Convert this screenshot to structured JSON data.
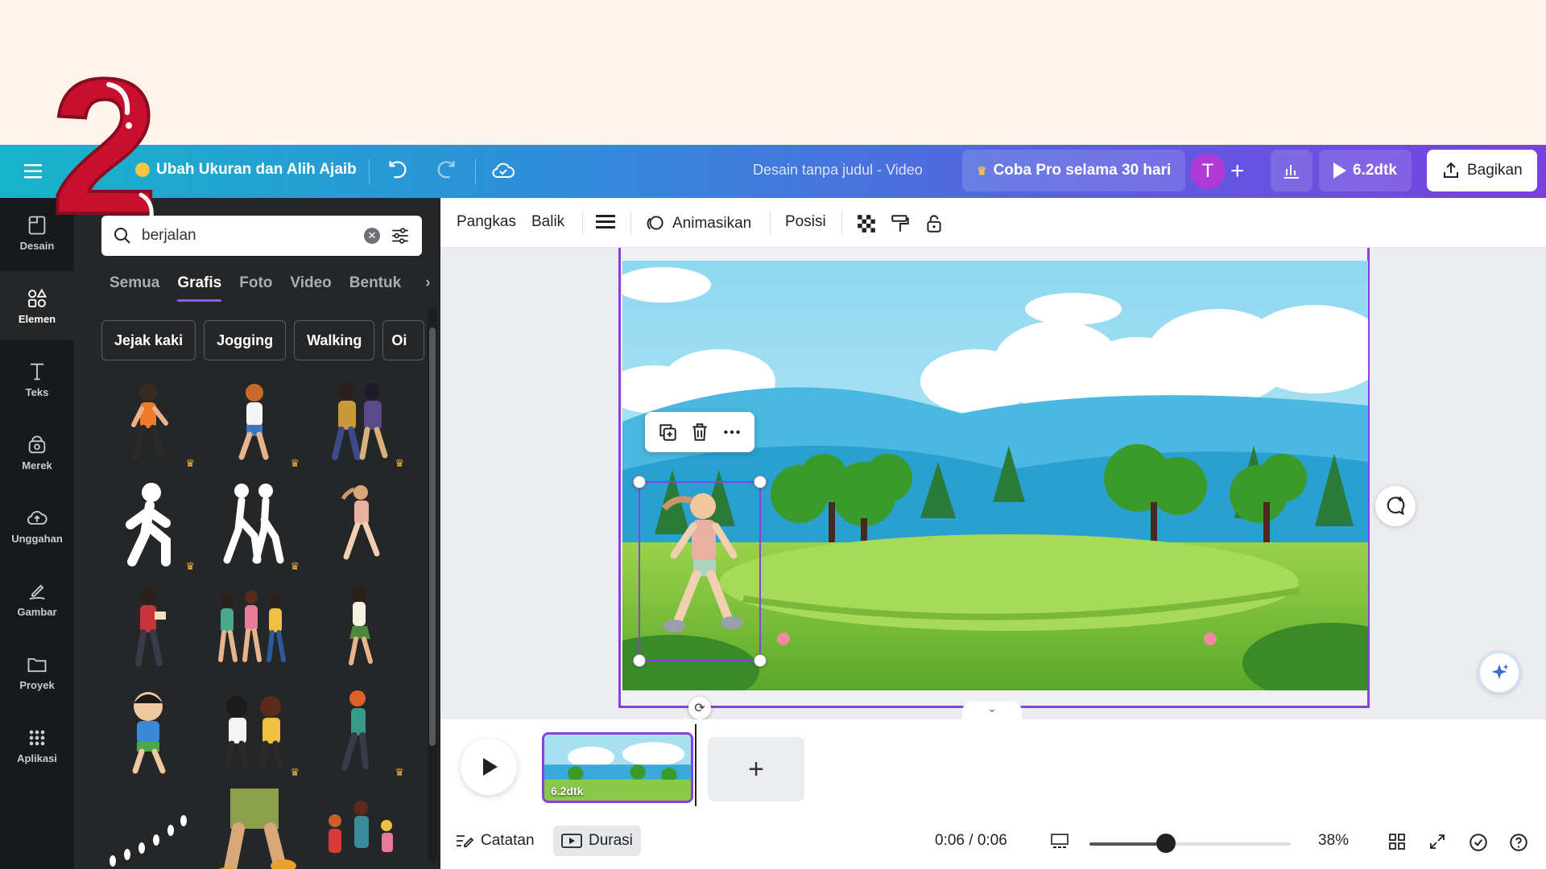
{
  "badge": {
    "number": "2"
  },
  "topbar": {
    "resize_label": "Ubah Ukuran dan Alih Ajaib",
    "doc_title": "Desain tanpa judul - Video",
    "pro_label": "Coba Pro selama 30 hari",
    "avatar_initial": "T",
    "play_label": "6.2dtk",
    "share_label": "Bagikan"
  },
  "rail": {
    "items": [
      {
        "label": "Desain",
        "icon": "layout-icon"
      },
      {
        "label": "Elemen",
        "icon": "shapes-icon"
      },
      {
        "label": "Teks",
        "icon": "text-icon"
      },
      {
        "label": "Merek",
        "icon": "brand-icon"
      },
      {
        "label": "Unggahan",
        "icon": "upload-cloud-icon"
      },
      {
        "label": "Gambar",
        "icon": "draw-icon"
      },
      {
        "label": "Proyek",
        "icon": "folder-icon"
      },
      {
        "label": "Aplikasi",
        "icon": "apps-grid-icon"
      }
    ]
  },
  "panel": {
    "search_value": "berjalan",
    "tabs": [
      "Semua",
      "Grafis",
      "Foto",
      "Video",
      "Bentuk"
    ],
    "active_tab": "Grafis",
    "chips": [
      "Jejak kaki",
      "Jogging",
      "Walking",
      "Oi"
    ]
  },
  "ctxbar": {
    "crop": "Pangkas",
    "flip": "Balik",
    "animate": "Animasikan",
    "position": "Posisi"
  },
  "timeline": {
    "clip_duration": "6.2dtk"
  },
  "bottombar": {
    "notes": "Catatan",
    "duration": "Durasi",
    "time": "0:06 / 0:06",
    "zoom": "38%",
    "zoom_fraction": 0.38
  },
  "colors": {
    "accent": "#8b3fe0",
    "badge_red": "#c8102e"
  }
}
